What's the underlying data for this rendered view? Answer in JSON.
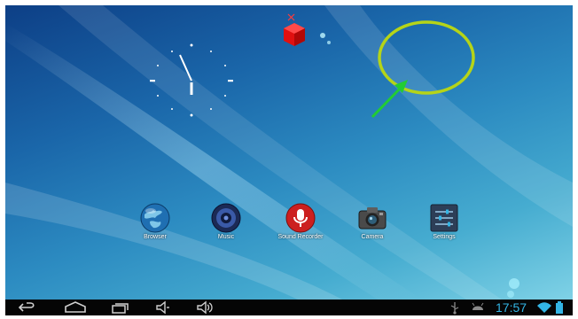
{
  "home": {
    "apps": [
      {
        "label": "Browser",
        "icon": "globe-icon"
      },
      {
        "label": "Music",
        "icon": "speaker-icon"
      },
      {
        "label": "Sound Recorder",
        "icon": "microphone-icon"
      },
      {
        "label": "Camera",
        "icon": "camera-icon"
      },
      {
        "label": "Settings",
        "icon": "sliders-icon"
      }
    ],
    "analog_clock": {
      "hour": 5,
      "minute": 57
    }
  },
  "statusbar": {
    "time": "17:57",
    "icons": [
      "usb-icon",
      "android-debug-icon",
      "wifi-icon",
      "battery-icon"
    ]
  },
  "navbar": {
    "buttons": [
      "back-icon",
      "home-icon",
      "recent-apps-icon",
      "volume-down-icon",
      "volume-up-icon"
    ]
  },
  "colors": {
    "accent": "#33b5e5",
    "annotation_circle": "#b5d418",
    "annotation_arrow": "#22cc33"
  }
}
